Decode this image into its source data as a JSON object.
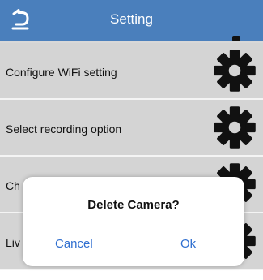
{
  "header": {
    "title": "Setting",
    "back_icon": "back-arrow-icon",
    "color": "#4a7fbc"
  },
  "settings": {
    "items": [
      {
        "label": "Configure WiFi setting",
        "icon": "gear-icon"
      },
      {
        "label": "Select recording option",
        "icon": "gear-icon"
      },
      {
        "label": "Ch",
        "icon": "gear-icon"
      },
      {
        "label": "Liv",
        "icon": "gear-icon"
      }
    ]
  },
  "dialog": {
    "title": "Delete Camera?",
    "cancel_label": "Cancel",
    "ok_label": "Ok",
    "button_color": "#2f6fd0"
  }
}
